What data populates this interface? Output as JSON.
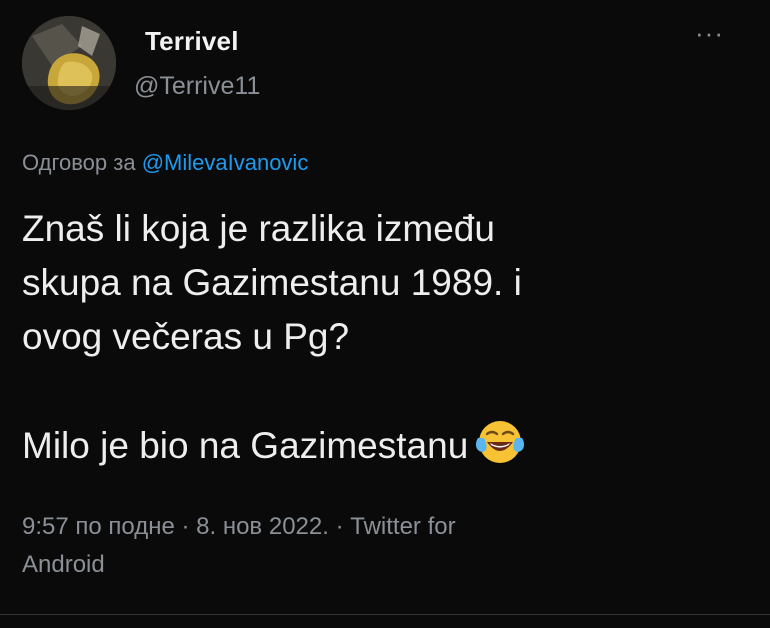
{
  "author": {
    "display_name": "Terrivel",
    "handle": "@Terrive11",
    "avatar_icon": "avatar-photo-icon"
  },
  "more_icon": "more-options-icon",
  "reply": {
    "prefix": "Одговор за ",
    "mention": "@MilevaIvanovic"
  },
  "tweet": {
    "lines": [
      "Znaš li koja je razlika između",
      "skupa na Gazimestanu 1989. i",
      "ovog večeras u Pg?"
    ],
    "second_paragraph": "Milo je bio na Gazimestanu",
    "emoji": "face-with-tears-of-joy-icon"
  },
  "meta": {
    "time": "9:57 по подне",
    "separator": " · ",
    "date": "8. нов 2022.",
    "separator2": " · ",
    "source_line1": "Twitter for",
    "source_line2": "Android"
  },
  "colors": {
    "background": "#0a0a0b",
    "text": "#eeeeee",
    "muted": "#8b9096",
    "link": "#1d9bf0"
  }
}
